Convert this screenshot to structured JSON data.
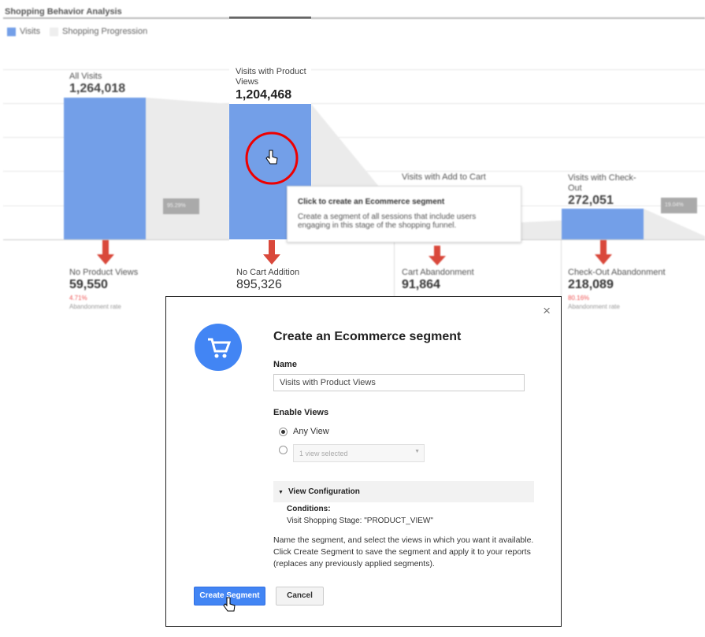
{
  "chart": {
    "title": "Shopping Behavior Analysis",
    "legend": [
      {
        "label": "Visits",
        "color": "#739fe8"
      },
      {
        "label": "Shopping Progression",
        "color": "#e8e8e8"
      }
    ],
    "stages": [
      {
        "label": "All Visits",
        "value": "1,264,018"
      },
      {
        "label": "Visits with Product Views",
        "value": "1,204,468"
      },
      {
        "label": "Visits with Add to Cart",
        "value": ""
      },
      {
        "label": "Visits with Check-Out",
        "value": "272,051"
      }
    ],
    "progressions": [
      "95.29%",
      "",
      "19.04%"
    ],
    "drops": [
      {
        "label": "No Product Views",
        "value": "59,550",
        "rate": "4.71%",
        "rate_label": "Abandonment rate"
      },
      {
        "label": "No Cart Addition",
        "value": "895,326",
        "rate": "",
        "rate_label": ""
      },
      {
        "label": "Cart Abandonment",
        "value": "91,864",
        "rate": "",
        "rate_label": ""
      },
      {
        "label": "Check-Out Abandonment",
        "value": "218,089",
        "rate": "80.16%",
        "rate_label": "Abandonment rate"
      }
    ]
  },
  "tooltip": {
    "title": "Click to create an Ecommerce segment",
    "body": "Create a segment of all sessions that include users engaging in this stage of the shopping funnel."
  },
  "dialog": {
    "title": "Create an Ecommerce segment",
    "icon": "cart-icon",
    "name_label": "Name",
    "name_value": "Visits with Product Views",
    "views_label": "Enable Views",
    "any_view": "Any View",
    "view_select": "1 view selected",
    "config_label": "View Configuration",
    "conditions_label": "Conditions:",
    "condition": "Visit Shopping Stage: \"PRODUCT_VIEW\"",
    "help": "Name the segment, and select the views in which you want it available. Click Create Segment to save the segment and apply it to your reports (replaces any previously applied segments).",
    "create": "Create Segment",
    "cancel": "Cancel",
    "accent": "#4285f4"
  }
}
